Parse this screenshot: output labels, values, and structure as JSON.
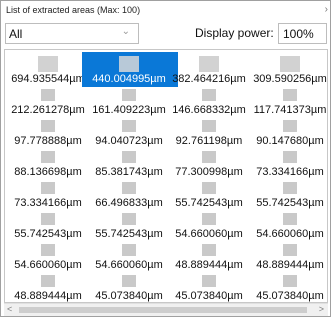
{
  "window": {
    "title": "List of extracted areas (Max: 100)"
  },
  "filter": {
    "selected": "All"
  },
  "display_power": {
    "label": "Display power:",
    "value": "100%"
  },
  "selected_index": 1,
  "items": [
    "694.935544µm",
    "440.004995µm",
    "382.464216µm",
    "309.590256µm",
    "212.261278µm",
    "161.409223µm",
    "146.668332µm",
    "117.741373µm",
    "97.778888µm",
    "94.040723µm",
    "92.761198µm",
    "90.147680µm",
    "88.136698µm",
    "85.381743µm",
    "77.300998µm",
    "73.334166µm",
    "73.334166µm",
    "66.496833µm",
    "55.742543µm",
    "55.742543µm",
    "55.742543µm",
    "55.742543µm",
    "54.660060µm",
    "54.660060µm",
    "54.660060µm",
    "54.660060µm",
    "48.889444µm",
    "48.889444µm",
    "48.889444µm",
    "45.073840µm",
    "45.073840µm",
    "45.073840µm"
  ]
}
